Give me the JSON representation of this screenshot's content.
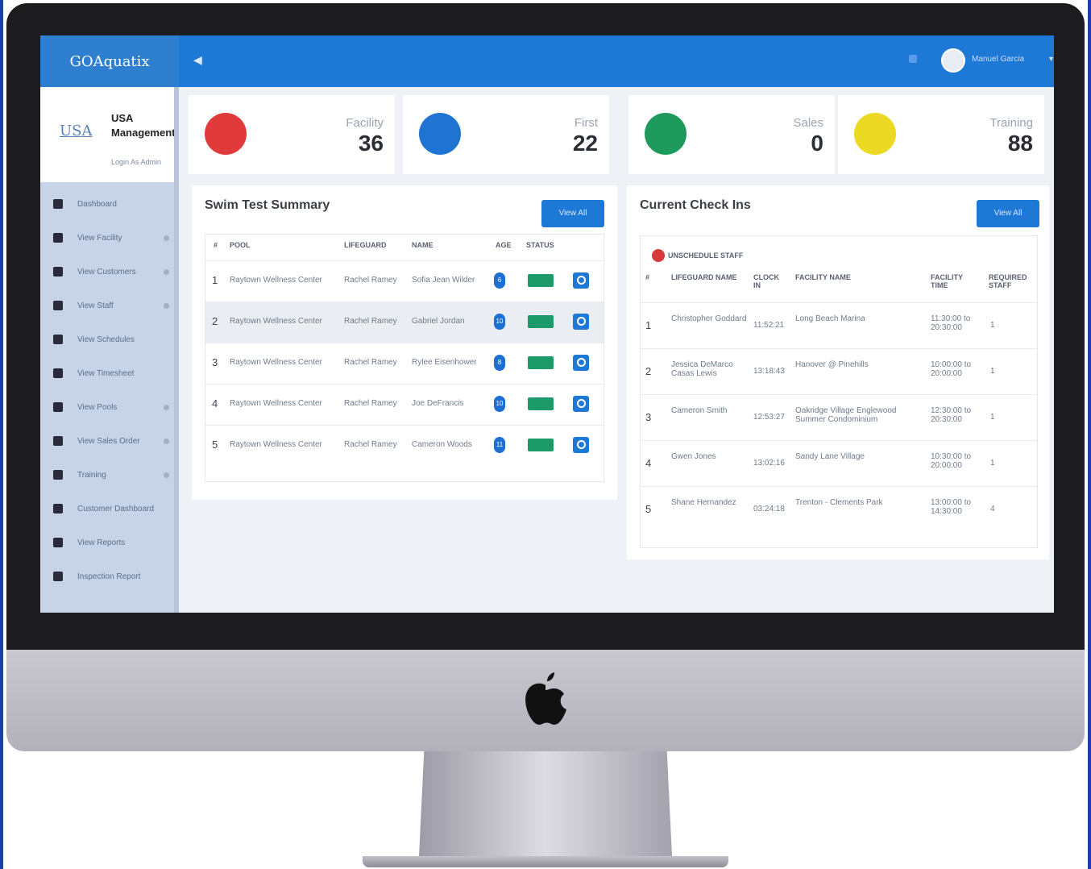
{
  "app": {
    "brand": "GOAquatix",
    "back_icon": "back-arrow-icon",
    "user": {
      "name": "Manuel Garcia"
    }
  },
  "company": {
    "logo": "USA",
    "name": "USA Management",
    "sub": "Login As Admin"
  },
  "sidebar": {
    "items": [
      {
        "label": "Dashboard",
        "icon": "home-icon",
        "has_arrow": false
      },
      {
        "label": "View Facility",
        "icon": "building-icon",
        "has_arrow": true
      },
      {
        "label": "View Customers",
        "icon": "users-icon",
        "has_arrow": true
      },
      {
        "label": "View Staff",
        "icon": "user-icon",
        "has_arrow": true
      },
      {
        "label": "View Schedules",
        "icon": "calendar-icon",
        "has_arrow": false
      },
      {
        "label": "View Timesheet",
        "icon": "clock-icon",
        "has_arrow": false
      },
      {
        "label": "View Pools",
        "icon": "pool-icon",
        "has_arrow": true
      },
      {
        "label": "View Sales Order",
        "icon": "cart-icon",
        "has_arrow": true
      },
      {
        "label": "Training",
        "icon": "training-icon",
        "has_arrow": true
      },
      {
        "label": "Customer Dashboard",
        "icon": "video-icon",
        "has_arrow": false
      },
      {
        "label": "View Reports",
        "icon": "report-icon",
        "has_arrow": false
      },
      {
        "label": "Inspection Report",
        "icon": "inspection-icon",
        "has_arrow": false
      }
    ]
  },
  "stats": [
    {
      "label": "Facility",
      "value": "36",
      "color": "#e03a3a",
      "icon": "facility-icon"
    },
    {
      "label": "First",
      "value": "22",
      "color": "#1f74d2",
      "icon": "first-aid-icon"
    },
    {
      "label": "Sales",
      "value": "0",
      "color": "#1d9a5c",
      "icon": "truck-icon"
    },
    {
      "label": "Training",
      "value": "88",
      "color": "#ecd923",
      "icon": "training-icon"
    }
  ],
  "swim": {
    "title": "Swim Test Summary",
    "view_btn": "View All",
    "headers": [
      "#",
      "POOL",
      "LIFEGUARD",
      "NAME",
      "AGE",
      "STATUS"
    ],
    "rows": [
      {
        "n": "1",
        "pool": "Raytown Wellness Center",
        "lifeguard": "Rachel Ramey",
        "name": "Sofia Jean Wilder",
        "age": "6"
      },
      {
        "n": "2",
        "pool": "Raytown Wellness Center",
        "lifeguard": "Rachel Ramey",
        "name": "Gabriel Jordan",
        "age": "10"
      },
      {
        "n": "3",
        "pool": "Raytown Wellness Center",
        "lifeguard": "Rachel Ramey",
        "name": "Rylee Eisenhower",
        "age": "8"
      },
      {
        "n": "4",
        "pool": "Raytown Wellness Center",
        "lifeguard": "Rachel Ramey",
        "name": "Joe DeFrancis",
        "age": "10"
      },
      {
        "n": "5",
        "pool": "Raytown Wellness Center",
        "lifeguard": "Rachel Ramey",
        "name": "Cameron Woods",
        "age": "11"
      }
    ]
  },
  "checkins": {
    "title": "Current Check Ins",
    "view_btn": "View All",
    "unsched_label": "UNSCHEDULE STAFF",
    "headers": [
      "#",
      "LIFEGUARD NAME",
      "CLOCK IN",
      "FACILITY NAME",
      "FACILITY TIME",
      "REQUIRED STAFF"
    ],
    "rows": [
      {
        "n": "1",
        "name": "Christopher Goddard",
        "clock": "11:52:21",
        "facility": "Long Beach Marina",
        "time": "11:30:00 to 20:30:00",
        "req": "1"
      },
      {
        "n": "2",
        "name": "Jessica DeMarco Casas Lewis",
        "clock": "13:18:43",
        "facility": "Hanover @ Pinehills",
        "time": "10:00:00 to 20:00:00",
        "req": "1"
      },
      {
        "n": "3",
        "name": "Cameron Smith",
        "clock": "12:53:27",
        "facility": "Oakridge Village Englewood Summer Condominium",
        "time": "12:30:00 to 20:30:00",
        "req": "1"
      },
      {
        "n": "4",
        "name": "Gwen Jones",
        "clock": "13:02:16",
        "facility": "Sandy Lane Village",
        "time": "10:30:00 to 20:00:00",
        "req": "1"
      },
      {
        "n": "5",
        "name": "Shane Hernandez",
        "clock": "03:24:18",
        "facility": "Trenton - Clements Park",
        "time": "13:00:00 to 14:30:00",
        "req": "4"
      }
    ]
  }
}
